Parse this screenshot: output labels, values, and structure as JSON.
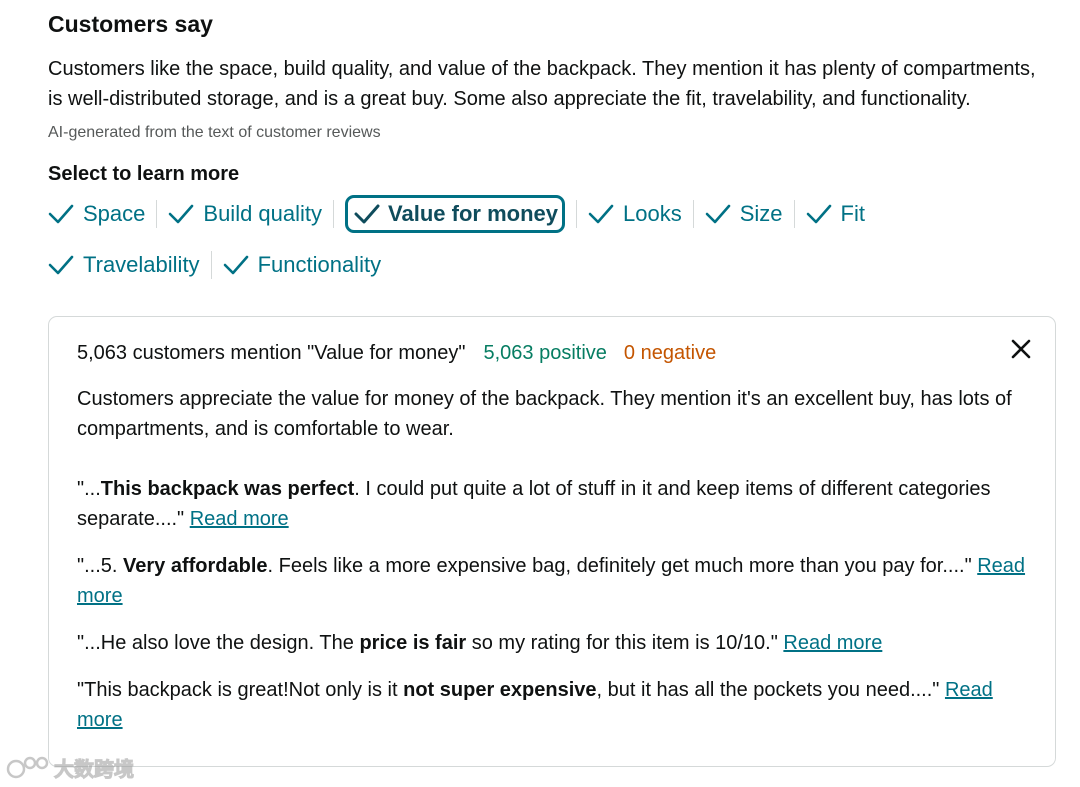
{
  "section": {
    "heading": "Customers say",
    "summary": "Customers like the space, build quality, and value of the backpack. They mention it has plenty of compartments, is well-distributed storage, and is a great buy. Some also appreciate the fit, travelability, and functionality.",
    "ai_note": "AI-generated from the text of customer reviews",
    "select_title": "Select to learn more"
  },
  "chips": [
    {
      "label": "Space",
      "selected": false
    },
    {
      "label": "Build quality",
      "selected": false
    },
    {
      "label": "Value for money",
      "selected": true
    },
    {
      "label": "Looks",
      "selected": false
    },
    {
      "label": "Size",
      "selected": false
    },
    {
      "label": "Fit",
      "selected": false
    },
    {
      "label": "Travelability",
      "selected": false
    },
    {
      "label": "Functionality",
      "selected": false
    }
  ],
  "panel": {
    "mention_text": "5,063 customers mention \"Value for money\"",
    "positive_text": "5,063 positive",
    "negative_text": "0 negative",
    "summary": "Customers appreciate the value for money of the backpack. They mention it's an excellent buy, has lots of compartments, and is comfortable to wear.",
    "quotes": [
      {
        "before": "\"...",
        "bold": "This backpack was perfect",
        "after": ". I could put quite a lot of stuff in it and keep items of different categories separate....\" ",
        "link": "Read more"
      },
      {
        "before": "\"...5. ",
        "bold": "Very affordable",
        "after": ". Feels like a more expensive bag, definitely get much more than you pay for....\" ",
        "link": "Read more"
      },
      {
        "before": "\"...He also love the design. The ",
        "bold": "price is fair",
        "after": " so my rating for this item is 10/10.\" ",
        "link": "Read more"
      },
      {
        "before": "\"This backpack is great!Not only is it ",
        "bold": "not super expensive",
        "after": ", but it has all the pockets you need....\" ",
        "link": "Read more"
      }
    ]
  },
  "colors": {
    "link": "#007185",
    "positive": "#067d62",
    "negative": "#c45500",
    "text": "#0f1111",
    "muted": "#565959"
  },
  "icons": {
    "chip_check": "check-icon",
    "close": "close-icon",
    "watermark_logo": "watermark-logo-icon"
  },
  "watermark": {
    "text": "大数跨境"
  }
}
